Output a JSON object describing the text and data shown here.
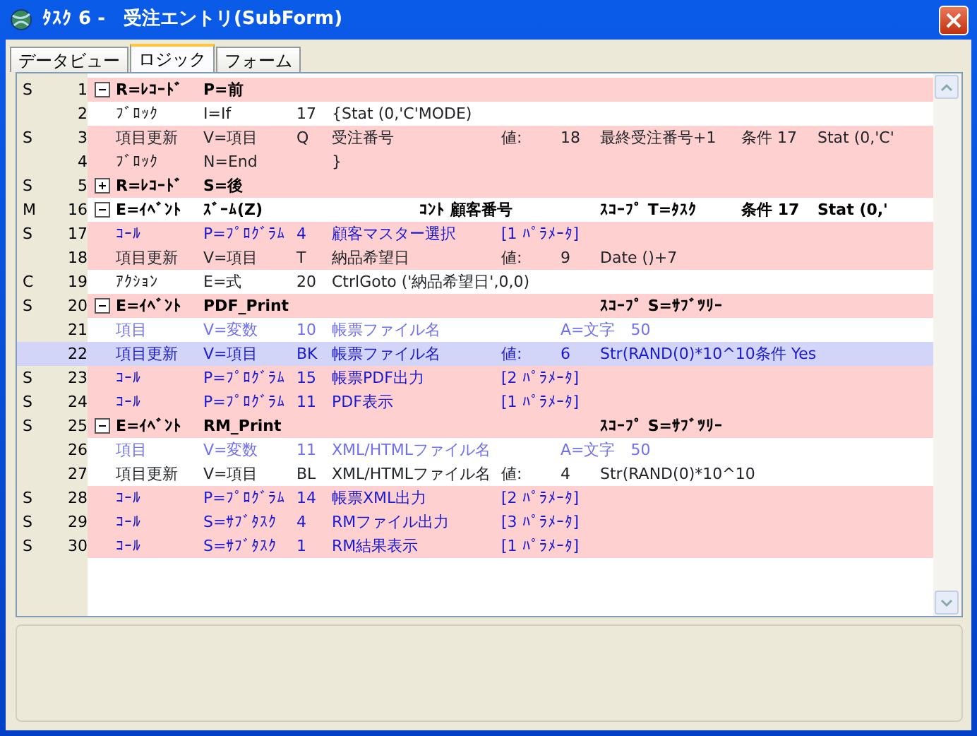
{
  "window": {
    "title": "ﾀｽｸ 6 -　受注エントリ(SubForm)"
  },
  "tabs": [
    {
      "label": "データビュー",
      "selected": false
    },
    {
      "label": "ロジック",
      "selected": true
    },
    {
      "label": "フォーム",
      "selected": false
    }
  ],
  "rows": [
    {
      "flag": "S",
      "line": "1",
      "kind": "header",
      "expanded": true,
      "marked": true,
      "selected": false,
      "cells": [
        {
          "kind": "type",
          "text": "R=ﾚｺｰﾄﾞ"
        },
        {
          "kind": "op",
          "text": "P=前"
        }
      ]
    },
    {
      "flag": "",
      "line": "2",
      "kind": "plain",
      "marked": false,
      "selected": false,
      "cells": [
        {
          "kind": "type",
          "text": "ﾌﾞﾛｯｸ"
        },
        {
          "kind": "op",
          "text": "I=If"
        },
        {
          "kind": "num",
          "text": "17"
        },
        {
          "kind": "name",
          "text": "{Stat (0,'C'MODE)"
        }
      ]
    },
    {
      "flag": "S",
      "line": "3",
      "kind": "plain",
      "marked": true,
      "selected": false,
      "cells": [
        {
          "kind": "type",
          "text": "項目更新"
        },
        {
          "kind": "op",
          "text": "V=項目"
        },
        {
          "kind": "num",
          "text": "Q"
        },
        {
          "kind": "name",
          "text": "受注番号"
        },
        {
          "kind": "value_label",
          "text": "値:"
        },
        {
          "kind": "value_num",
          "text": "18"
        },
        {
          "kind": "expr",
          "text": "最終受注番号+1"
        },
        {
          "kind": "cond",
          "text": "条件 17"
        },
        {
          "kind": "cond_expr",
          "text": "Stat (0,'C'"
        }
      ]
    },
    {
      "flag": "",
      "line": "4",
      "kind": "plain",
      "marked": true,
      "selected": false,
      "cells": [
        {
          "kind": "type",
          "text": "ﾌﾞﾛｯｸ"
        },
        {
          "kind": "op",
          "text": "N=End"
        },
        {
          "kind": "name",
          "text": "}"
        }
      ]
    },
    {
      "flag": "S",
      "line": "5",
      "kind": "header",
      "expanded": false,
      "marked": true,
      "selected": false,
      "cells": [
        {
          "kind": "type",
          "text": "R=ﾚｺｰﾄﾞ"
        },
        {
          "kind": "op",
          "text": "S=後"
        }
      ]
    },
    {
      "flag": "M",
      "line": "16",
      "kind": "header",
      "expanded": true,
      "marked": false,
      "selected": false,
      "cells": [
        {
          "kind": "type",
          "text": "E=ｲﾍﾞﾝﾄ"
        },
        {
          "kind": "op",
          "text": "ｽﾞｰﾑ(Z)"
        },
        {
          "kind": "control",
          "text": "ｺﾝﾄ 顧客番号"
        },
        {
          "kind": "expr",
          "text": "ｽｺｰﾌﾟ T=ﾀｽｸ"
        },
        {
          "kind": "cond",
          "text": "条件 17"
        },
        {
          "kind": "cond_expr",
          "text": "Stat (0,'"
        }
      ]
    },
    {
      "flag": "S",
      "line": "17",
      "kind": "call",
      "marked": true,
      "selected": false,
      "cells": [
        {
          "kind": "type",
          "text": "ｺｰﾙ"
        },
        {
          "kind": "op",
          "text": "P=ﾌﾟﾛｸﾞﾗﾑ"
        },
        {
          "kind": "num",
          "text": "4"
        },
        {
          "kind": "name",
          "text": "顧客マスター選択"
        },
        {
          "kind": "params",
          "text": "[1 ﾊﾟﾗﾒｰﾀ]"
        }
      ]
    },
    {
      "flag": "",
      "line": "18",
      "kind": "plain",
      "marked": true,
      "selected": false,
      "cells": [
        {
          "kind": "type",
          "text": "項目更新"
        },
        {
          "kind": "op",
          "text": "V=項目"
        },
        {
          "kind": "num",
          "text": "T"
        },
        {
          "kind": "name",
          "text": "納品希望日"
        },
        {
          "kind": "value_label",
          "text": "値:"
        },
        {
          "kind": "value_num",
          "text": "9"
        },
        {
          "kind": "expr",
          "text": "Date ()+7"
        }
      ]
    },
    {
      "flag": "C",
      "line": "19",
      "kind": "plain",
      "marked": false,
      "selected": false,
      "cells": [
        {
          "kind": "type",
          "text": "ｱｸｼｮﾝ"
        },
        {
          "kind": "op",
          "text": "E=式"
        },
        {
          "kind": "num",
          "text": "20"
        },
        {
          "kind": "long",
          "text": "CtrlGoto ('納品希望日',0,0)"
        }
      ]
    },
    {
      "flag": "S",
      "line": "20",
      "kind": "header",
      "expanded": true,
      "marked": true,
      "selected": false,
      "cells": [
        {
          "kind": "type",
          "text": "E=ｲﾍﾞﾝﾄ"
        },
        {
          "kind": "op",
          "text": "PDF_Print"
        },
        {
          "kind": "expr",
          "text": "ｽｺｰﾌﾟ S=ｻﾌﾞﾂﾘｰ"
        }
      ]
    },
    {
      "flag": "",
      "line": "21",
      "kind": "var",
      "marked": false,
      "selected": false,
      "cells": [
        {
          "kind": "type",
          "text": "項目"
        },
        {
          "kind": "op",
          "text": "V=変数"
        },
        {
          "kind": "num",
          "text": "10"
        },
        {
          "kind": "name",
          "text": "帳票ファイル名"
        },
        {
          "kind": "attr",
          "text": "A=文字　50"
        }
      ]
    },
    {
      "flag": "",
      "line": "22",
      "kind": "plain",
      "marked": false,
      "selected": true,
      "cells": [
        {
          "kind": "type",
          "text": "項目更新"
        },
        {
          "kind": "op",
          "text": "V=項目"
        },
        {
          "kind": "num",
          "text": "BK"
        },
        {
          "kind": "name",
          "text": "帳票ファイル名"
        },
        {
          "kind": "value_label",
          "text": "値:"
        },
        {
          "kind": "value_num",
          "text": "6"
        },
        {
          "kind": "tail",
          "text": "Str(RAND(0)*10^10条件 Yes"
        }
      ]
    },
    {
      "flag": "S",
      "line": "23",
      "kind": "call",
      "marked": true,
      "selected": false,
      "cells": [
        {
          "kind": "type",
          "text": "ｺｰﾙ"
        },
        {
          "kind": "op",
          "text": "P=ﾌﾟﾛｸﾞﾗﾑ"
        },
        {
          "kind": "num",
          "text": "15"
        },
        {
          "kind": "name",
          "text": "帳票PDF出力"
        },
        {
          "kind": "params",
          "text": "[2 ﾊﾟﾗﾒｰﾀ]"
        }
      ]
    },
    {
      "flag": "S",
      "line": "24",
      "kind": "call",
      "marked": true,
      "selected": false,
      "cells": [
        {
          "kind": "type",
          "text": "ｺｰﾙ"
        },
        {
          "kind": "op",
          "text": "P=ﾌﾟﾛｸﾞﾗﾑ"
        },
        {
          "kind": "num",
          "text": "11"
        },
        {
          "kind": "name",
          "text": "PDF表示"
        },
        {
          "kind": "params",
          "text": "[1 ﾊﾟﾗﾒｰﾀ]"
        }
      ]
    },
    {
      "flag": "S",
      "line": "25",
      "kind": "header",
      "expanded": true,
      "marked": true,
      "selected": false,
      "cells": [
        {
          "kind": "type",
          "text": "E=ｲﾍﾞﾝﾄ"
        },
        {
          "kind": "op",
          "text": "RM_Print"
        },
        {
          "kind": "expr",
          "text": "ｽｺｰﾌﾟ S=ｻﾌﾞﾂﾘｰ"
        }
      ]
    },
    {
      "flag": "",
      "line": "26",
      "kind": "var",
      "marked": false,
      "selected": false,
      "cells": [
        {
          "kind": "type",
          "text": "項目"
        },
        {
          "kind": "op",
          "text": "V=変数"
        },
        {
          "kind": "num",
          "text": "11"
        },
        {
          "kind": "name",
          "text": "XML/HTMLファイル名"
        },
        {
          "kind": "attr",
          "text": "A=文字　50"
        }
      ]
    },
    {
      "flag": "",
      "line": "27",
      "kind": "plain",
      "marked": false,
      "selected": false,
      "cells": [
        {
          "kind": "type",
          "text": "項目更新"
        },
        {
          "kind": "op",
          "text": "V=項目"
        },
        {
          "kind": "num",
          "text": "BL"
        },
        {
          "kind": "name",
          "text": "XML/HTMLファイル名"
        },
        {
          "kind": "value_label",
          "text": "値:"
        },
        {
          "kind": "value_num",
          "text": "4"
        },
        {
          "kind": "tail",
          "text": "Str(RAND(0)*10^10"
        }
      ]
    },
    {
      "flag": "S",
      "line": "28",
      "kind": "call",
      "marked": true,
      "selected": false,
      "cells": [
        {
          "kind": "type",
          "text": "ｺｰﾙ"
        },
        {
          "kind": "op",
          "text": "P=ﾌﾟﾛｸﾞﾗﾑ"
        },
        {
          "kind": "num",
          "text": "14"
        },
        {
          "kind": "name",
          "text": "帳票XML出力"
        },
        {
          "kind": "params",
          "text": "[2 ﾊﾟﾗﾒｰﾀ]"
        }
      ]
    },
    {
      "flag": "S",
      "line": "29",
      "kind": "call",
      "marked": true,
      "selected": false,
      "cells": [
        {
          "kind": "type",
          "text": "ｺｰﾙ"
        },
        {
          "kind": "op",
          "text": "S=ｻﾌﾞﾀｽｸ"
        },
        {
          "kind": "num",
          "text": "4"
        },
        {
          "kind": "name",
          "text": "RMファイル出力"
        },
        {
          "kind": "params",
          "text": "[3 ﾊﾟﾗﾒｰﾀ]"
        }
      ]
    },
    {
      "flag": "S",
      "line": "30",
      "kind": "call",
      "marked": true,
      "selected": false,
      "cells": [
        {
          "kind": "type",
          "text": "ｺｰﾙ"
        },
        {
          "kind": "op",
          "text": "S=ｻﾌﾞﾀｽｸ"
        },
        {
          "kind": "num",
          "text": "1"
        },
        {
          "kind": "name",
          "text": "RM結果表示"
        },
        {
          "kind": "params",
          "text": "[1 ﾊﾟﾗﾒｰﾀ]"
        }
      ]
    }
  ]
}
